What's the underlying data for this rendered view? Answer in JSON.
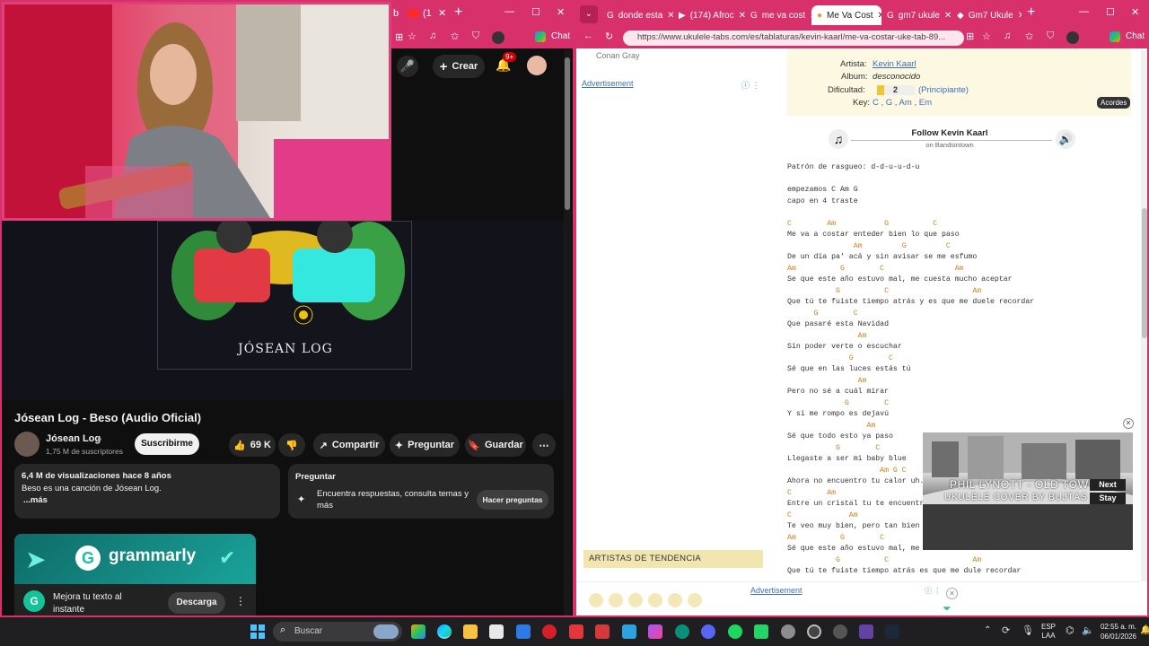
{
  "left_window": {
    "tabs": [
      "b",
      "(1"
    ],
    "chat_label": "Chat",
    "header": {
      "create_label": "Crear",
      "notif_count": "9+"
    },
    "video": {
      "thumb_caption": "JÓSEAN LOG",
      "title": "Jósean Log - Beso (Audio Oficial)",
      "channel": "Jósean Log",
      "subscribers": "1,75 M de suscriptores",
      "subscribe_label": "Suscribirme",
      "likes": "69 K",
      "share_label": "Compartir",
      "ask_label": "Preguntar",
      "save_label": "Guardar",
      "views_line": "6,4 M de visualizaciones  hace 8 años",
      "description": "Beso es una canción de Jósean Log.",
      "more_label": "...más"
    },
    "ask_card": {
      "title": "Preguntar",
      "text": "Encuentra respuestas, consulta temas y más",
      "button": "Hacer preguntas"
    },
    "ad": {
      "brand": "grammarly",
      "text": "Mejora tu texto al instante",
      "button": "Descarga"
    }
  },
  "right_window": {
    "tabs": [
      {
        "label": "donde esta",
        "active": false
      },
      {
        "label": "(174) Afroc",
        "active": false
      },
      {
        "label": "me va cost",
        "active": false
      },
      {
        "label": "Me Va Cost",
        "active": true
      },
      {
        "label": "gm7 ukule",
        "active": false
      },
      {
        "label": "Gm7 Ukule",
        "active": false
      }
    ],
    "url": "https://www.ukulele-tabs.com/es/tablaturas/kevin-kaarl/me-va-costar-uke-tab-89...",
    "chat_label": "Chat",
    "sidebar": {
      "conan": "Conan Gray",
      "advertisement": "Advertisement",
      "trending": "ARTISTAS DE TENDENCIA"
    },
    "info": {
      "artist_label": "Artista:",
      "artist": "Kevin Kaarl",
      "album_label": "Album:",
      "album": "desconocido",
      "difficulty_label": "Dificultad:",
      "difficulty_value": "2",
      "difficulty_text": "(Principiante)",
      "key_label": "Key:",
      "keys": "C , G , Am , Em",
      "acordes": "Acordes"
    },
    "follow": {
      "title": "Follow Kevin Kaarl",
      "sub": "on Bandsintown"
    },
    "tab_lines": [
      {
        "t": "text",
        "s": "Patrón de rasgueo: d-d-u-u-d-u"
      },
      {
        "t": "blank",
        "s": ""
      },
      {
        "t": "text",
        "s": "empezamos C Am G"
      },
      {
        "t": "text",
        "s": "capo en 4 traste"
      },
      {
        "t": "blank",
        "s": ""
      },
      {
        "t": "chord",
        "s": "C        Am           G          C"
      },
      {
        "t": "text",
        "s": "Me va a costar enteder bien lo que paso"
      },
      {
        "t": "chord",
        "s": "               Am         G         C"
      },
      {
        "t": "text",
        "s": "De un día pa' acá y sin avisar se me esfumo"
      },
      {
        "t": "chord",
        "s": "Am          G        C                Am"
      },
      {
        "t": "text",
        "s": "Se que este año estuvo mal, me cuesta mucho aceptar"
      },
      {
        "t": "chord",
        "s": "           G          C                   Am"
      },
      {
        "t": "text",
        "s": "Que tú te fuiste tiempo atrás y es que me duele recordar"
      },
      {
        "t": "chord",
        "s": "      G        C"
      },
      {
        "t": "text",
        "s": "Que pasaré esta Navidad"
      },
      {
        "t": "chord",
        "s": "                Am"
      },
      {
        "t": "text",
        "s": "Sin poder verte o escuchar"
      },
      {
        "t": "chord",
        "s": "              G        C"
      },
      {
        "t": "text",
        "s": "Sé que en las luces estás tú"
      },
      {
        "t": "chord",
        "s": "                Am"
      },
      {
        "t": "text",
        "s": "Pero no sé a cuál mirar"
      },
      {
        "t": "chord",
        "s": "             G        C"
      },
      {
        "t": "text",
        "s": "Y si me rompo es dejavú"
      },
      {
        "t": "chord",
        "s": "                  Am"
      },
      {
        "t": "text",
        "s": "Sé que todo esto ya paso"
      },
      {
        "t": "chord",
        "s": "           G        C"
      },
      {
        "t": "text",
        "s": "Llegaste a ser mi baby blue"
      },
      {
        "t": "chord",
        "s": "                     Am G C"
      },
      {
        "t": "text",
        "s": "Ahora no encuentro tu calor uh."
      },
      {
        "t": "chord",
        "s": "C        Am"
      },
      {
        "t": "text",
        "s": "Entre un cristal tu te encuentra"
      },
      {
        "t": "chord",
        "s": "C             Am"
      },
      {
        "t": "text",
        "s": "Te veo muy bien, pero tan bien a"
      },
      {
        "t": "chord",
        "s": "Am          G        C"
      },
      {
        "t": "text",
        "s": "Sé que este año estuvo mal, me c"
      },
      {
        "t": "chord",
        "s": "           G          C                   Am"
      },
      {
        "t": "text",
        "s": "Que tú te fuiste tiempo atrás es que me dule recordar"
      }
    ],
    "overlay": {
      "line1": "PHIL LYNOTT - OLD TOW",
      "line2": "UKULELE COVER BY BUJTÁS E",
      "next": "Next",
      "stay": "Stay"
    },
    "bottom_ad": "Advertisement"
  },
  "taskbar": {
    "search_placeholder": "Buscar",
    "lang": "ESP",
    "lang_sub": "LAA",
    "time": "02:55 a. m.",
    "date": "06/01/2026"
  },
  "colors": {
    "accent": "#d8306a",
    "chord": "#c9831f",
    "link": "#3b6fc4"
  }
}
